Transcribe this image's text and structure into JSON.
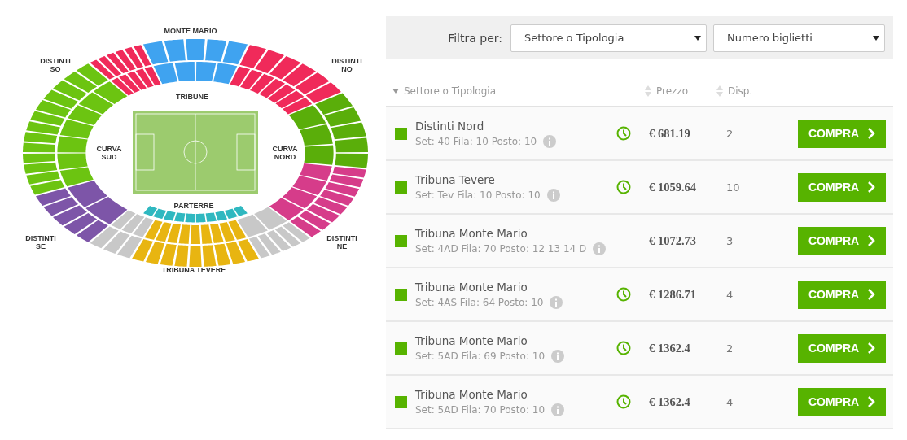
{
  "map": {
    "zones": [
      {
        "color": "#3fa3f0"
      },
      {
        "color": "#f02a5a"
      },
      {
        "color": "#5aae0a"
      },
      {
        "color": "#d63c8a"
      },
      {
        "color": "#c8c8c8"
      },
      {
        "color": "#e8b511"
      },
      {
        "color": "#c8c8c8"
      },
      {
        "color": "#7d55a8"
      },
      {
        "color": "#6cc411"
      },
      {
        "color": "#6cc411"
      },
      {
        "color": "#f02a5a"
      },
      {
        "color": "#2fb8c0"
      }
    ],
    "labels": [
      "MONTE MARIO",
      "TRIBUNE",
      "DISTINTI SO",
      "DISTINTI NO",
      "CURVA SUD",
      "CURVA NORD",
      "PARTERRE",
      "DISTINTI SE",
      "DISTINTI NE",
      "TRIBUNA TEVERE"
    ]
  },
  "filter": {
    "label": "Filtra per:",
    "selects": [
      "Settore o Tipologia",
      "Numero biglietti"
    ]
  },
  "columns": [
    "Settore o Tipologia",
    "Prezzo",
    "Disp."
  ],
  "rows": [
    {
      "color": "#57b300",
      "name": "Distinti Nord",
      "detail": "Set: 40 Fila: 10 Posto: 10",
      "clock": true,
      "price": "€ 681.19",
      "disp": "2",
      "button": "COMPRA"
    },
    {
      "color": "#57b300",
      "name": "Tribuna Tevere",
      "detail": "Set: Tev Fila: 10 Posto: 10",
      "clock": true,
      "price": "€ 1059.64",
      "disp": "10",
      "button": "COMPRA"
    },
    {
      "color": "#57b300",
      "name": "Tribuna Monte Mario",
      "detail": "Set: 4AD Fila: 70 Posto: 12 13 14 D",
      "clock": false,
      "price": "€ 1072.73",
      "disp": "3",
      "button": "COMPRA"
    },
    {
      "color": "#57b300",
      "name": "Tribuna Monte Mario",
      "detail": "Set: 4AS Fila: 64 Posto: 10",
      "clock": true,
      "price": "€ 1286.71",
      "disp": "4",
      "button": "COMPRA"
    },
    {
      "color": "#57b300",
      "name": "Tribuna Monte Mario",
      "detail": "Set: 5AD Fila: 69 Posto: 10",
      "clock": true,
      "price": "€ 1362.4",
      "disp": "2",
      "button": "COMPRA"
    },
    {
      "color": "#57b300",
      "name": "Tribuna Monte Mario",
      "detail": "Set: 5AD Fila: 70 Posto: 10",
      "clock": true,
      "price": "€ 1362.4",
      "disp": "4",
      "button": "COMPRA"
    }
  ]
}
